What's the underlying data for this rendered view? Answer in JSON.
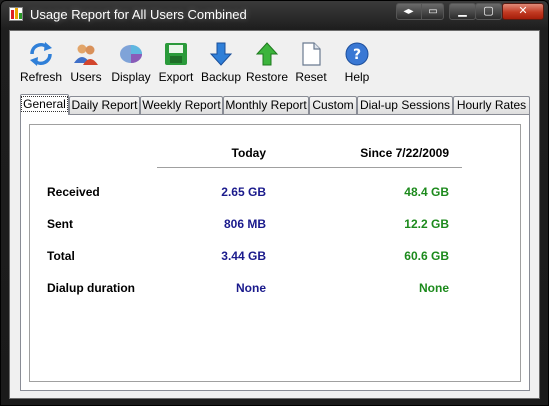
{
  "window": {
    "title": "Usage Report for All Users Combined",
    "controls": {
      "nav": "◂▸",
      "restore_small": "▭",
      "minimize": "▁",
      "maximize": "▢",
      "close": "✕"
    }
  },
  "toolbar": {
    "items": [
      {
        "label": "Refresh",
        "icon": "refresh-icon"
      },
      {
        "label": "Users",
        "icon": "users-icon"
      },
      {
        "label": "Display",
        "icon": "display-icon"
      },
      {
        "label": "Export",
        "icon": "export-icon"
      },
      {
        "label": "Backup",
        "icon": "backup-icon"
      },
      {
        "label": "Restore",
        "icon": "restore-icon"
      },
      {
        "label": "Reset",
        "icon": "reset-icon"
      },
      {
        "label": "Help",
        "icon": "help-icon"
      }
    ]
  },
  "tabs": [
    {
      "label": "General",
      "active": true
    },
    {
      "label": "Daily Report"
    },
    {
      "label": "Weekly Report"
    },
    {
      "label": "Monthly Report"
    },
    {
      "label": "Custom"
    },
    {
      "label": "Dial-up Sessions"
    },
    {
      "label": "Hourly Rates"
    }
  ],
  "report": {
    "col_today": "Today",
    "col_since": "Since 7/22/2009",
    "rows": [
      {
        "label": "Received",
        "today": "2.65 GB",
        "since": "48.4 GB"
      },
      {
        "label": "Sent",
        "today": "806 MB",
        "since": "12.2 GB"
      },
      {
        "label": "Total",
        "today": "3.44 GB",
        "since": "60.6 GB"
      },
      {
        "label": "Dialup duration",
        "today": "None",
        "since": "None"
      }
    ]
  },
  "colors": {
    "today": "#1a1a8c",
    "since": "#1c8a1c"
  }
}
